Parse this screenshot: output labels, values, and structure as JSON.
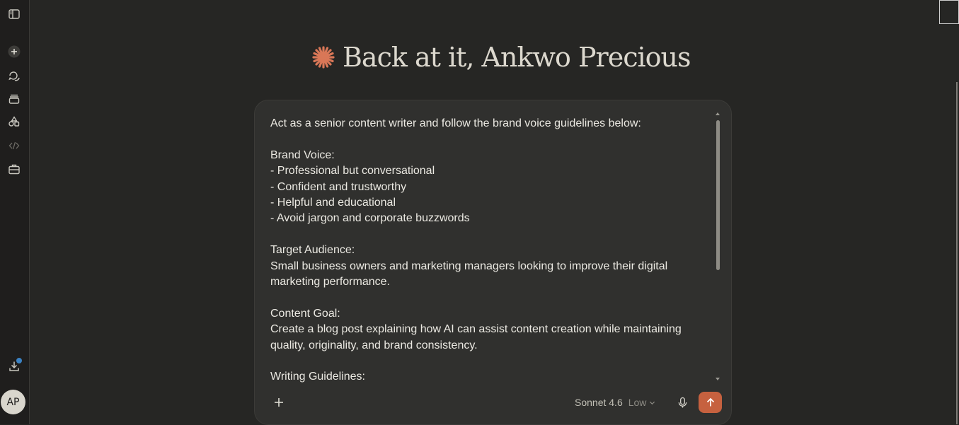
{
  "sidebar": {
    "icons": [
      "sidebar-toggle-icon",
      "new-chat-icon",
      "chats-icon",
      "projects-icon",
      "artifacts-icon",
      "code-icon",
      "tools-icon",
      "download-icon"
    ],
    "avatar_initials": "AP"
  },
  "greeting": {
    "text": "Back at it, Ankwo Precious",
    "icon": "claude-spark-icon",
    "accent_color": "#d97757"
  },
  "composer": {
    "prompt_lines": [
      "Act as a senior content writer and follow the brand voice guidelines below:",
      "",
      "Brand Voice:",
      "- Professional but conversational",
      "- Confident and trustworthy",
      "- Helpful and educational",
      "- Avoid jargon and corporate buzzwords",
      "",
      "Target Audience:",
      "Small business owners and marketing managers looking to improve their digital",
      "marketing performance.",
      "",
      "Content Goal:",
      "Create a blog post explaining how AI can assist content creation while maintaining",
      "quality, originality, and brand consistency.",
      "",
      "Writing Guidelines:"
    ],
    "model_name": "Sonnet 4.6",
    "effort": "Low",
    "send_color": "#c6613f"
  }
}
